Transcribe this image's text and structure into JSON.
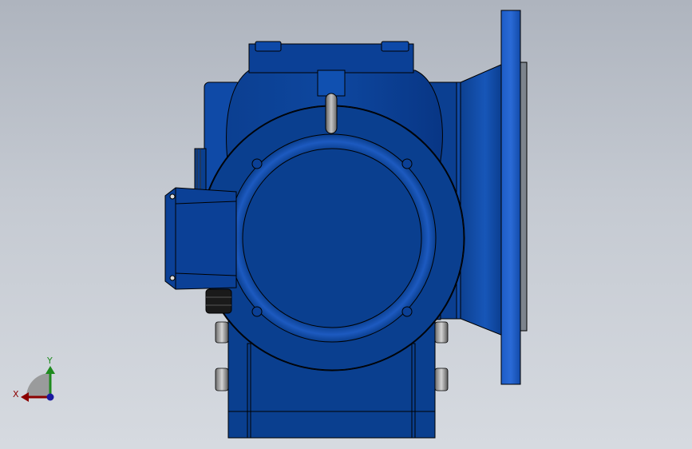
{
  "viewport": {
    "background_top": "#aeb4be",
    "background_bottom": "#d6dae0"
  },
  "model": {
    "body_color": "#0a3f8f",
    "highlight_color": "#1f5cc4",
    "shadow_color": "#062a63",
    "edge_color": "#000000",
    "lifting_eye_color": "#9a9a9a"
  },
  "triad": {
    "x_label": "X",
    "y_label": "Y",
    "x_color": "#8b0000",
    "y_color": "#1e8a1e",
    "z_color": "#1a1aa0"
  }
}
